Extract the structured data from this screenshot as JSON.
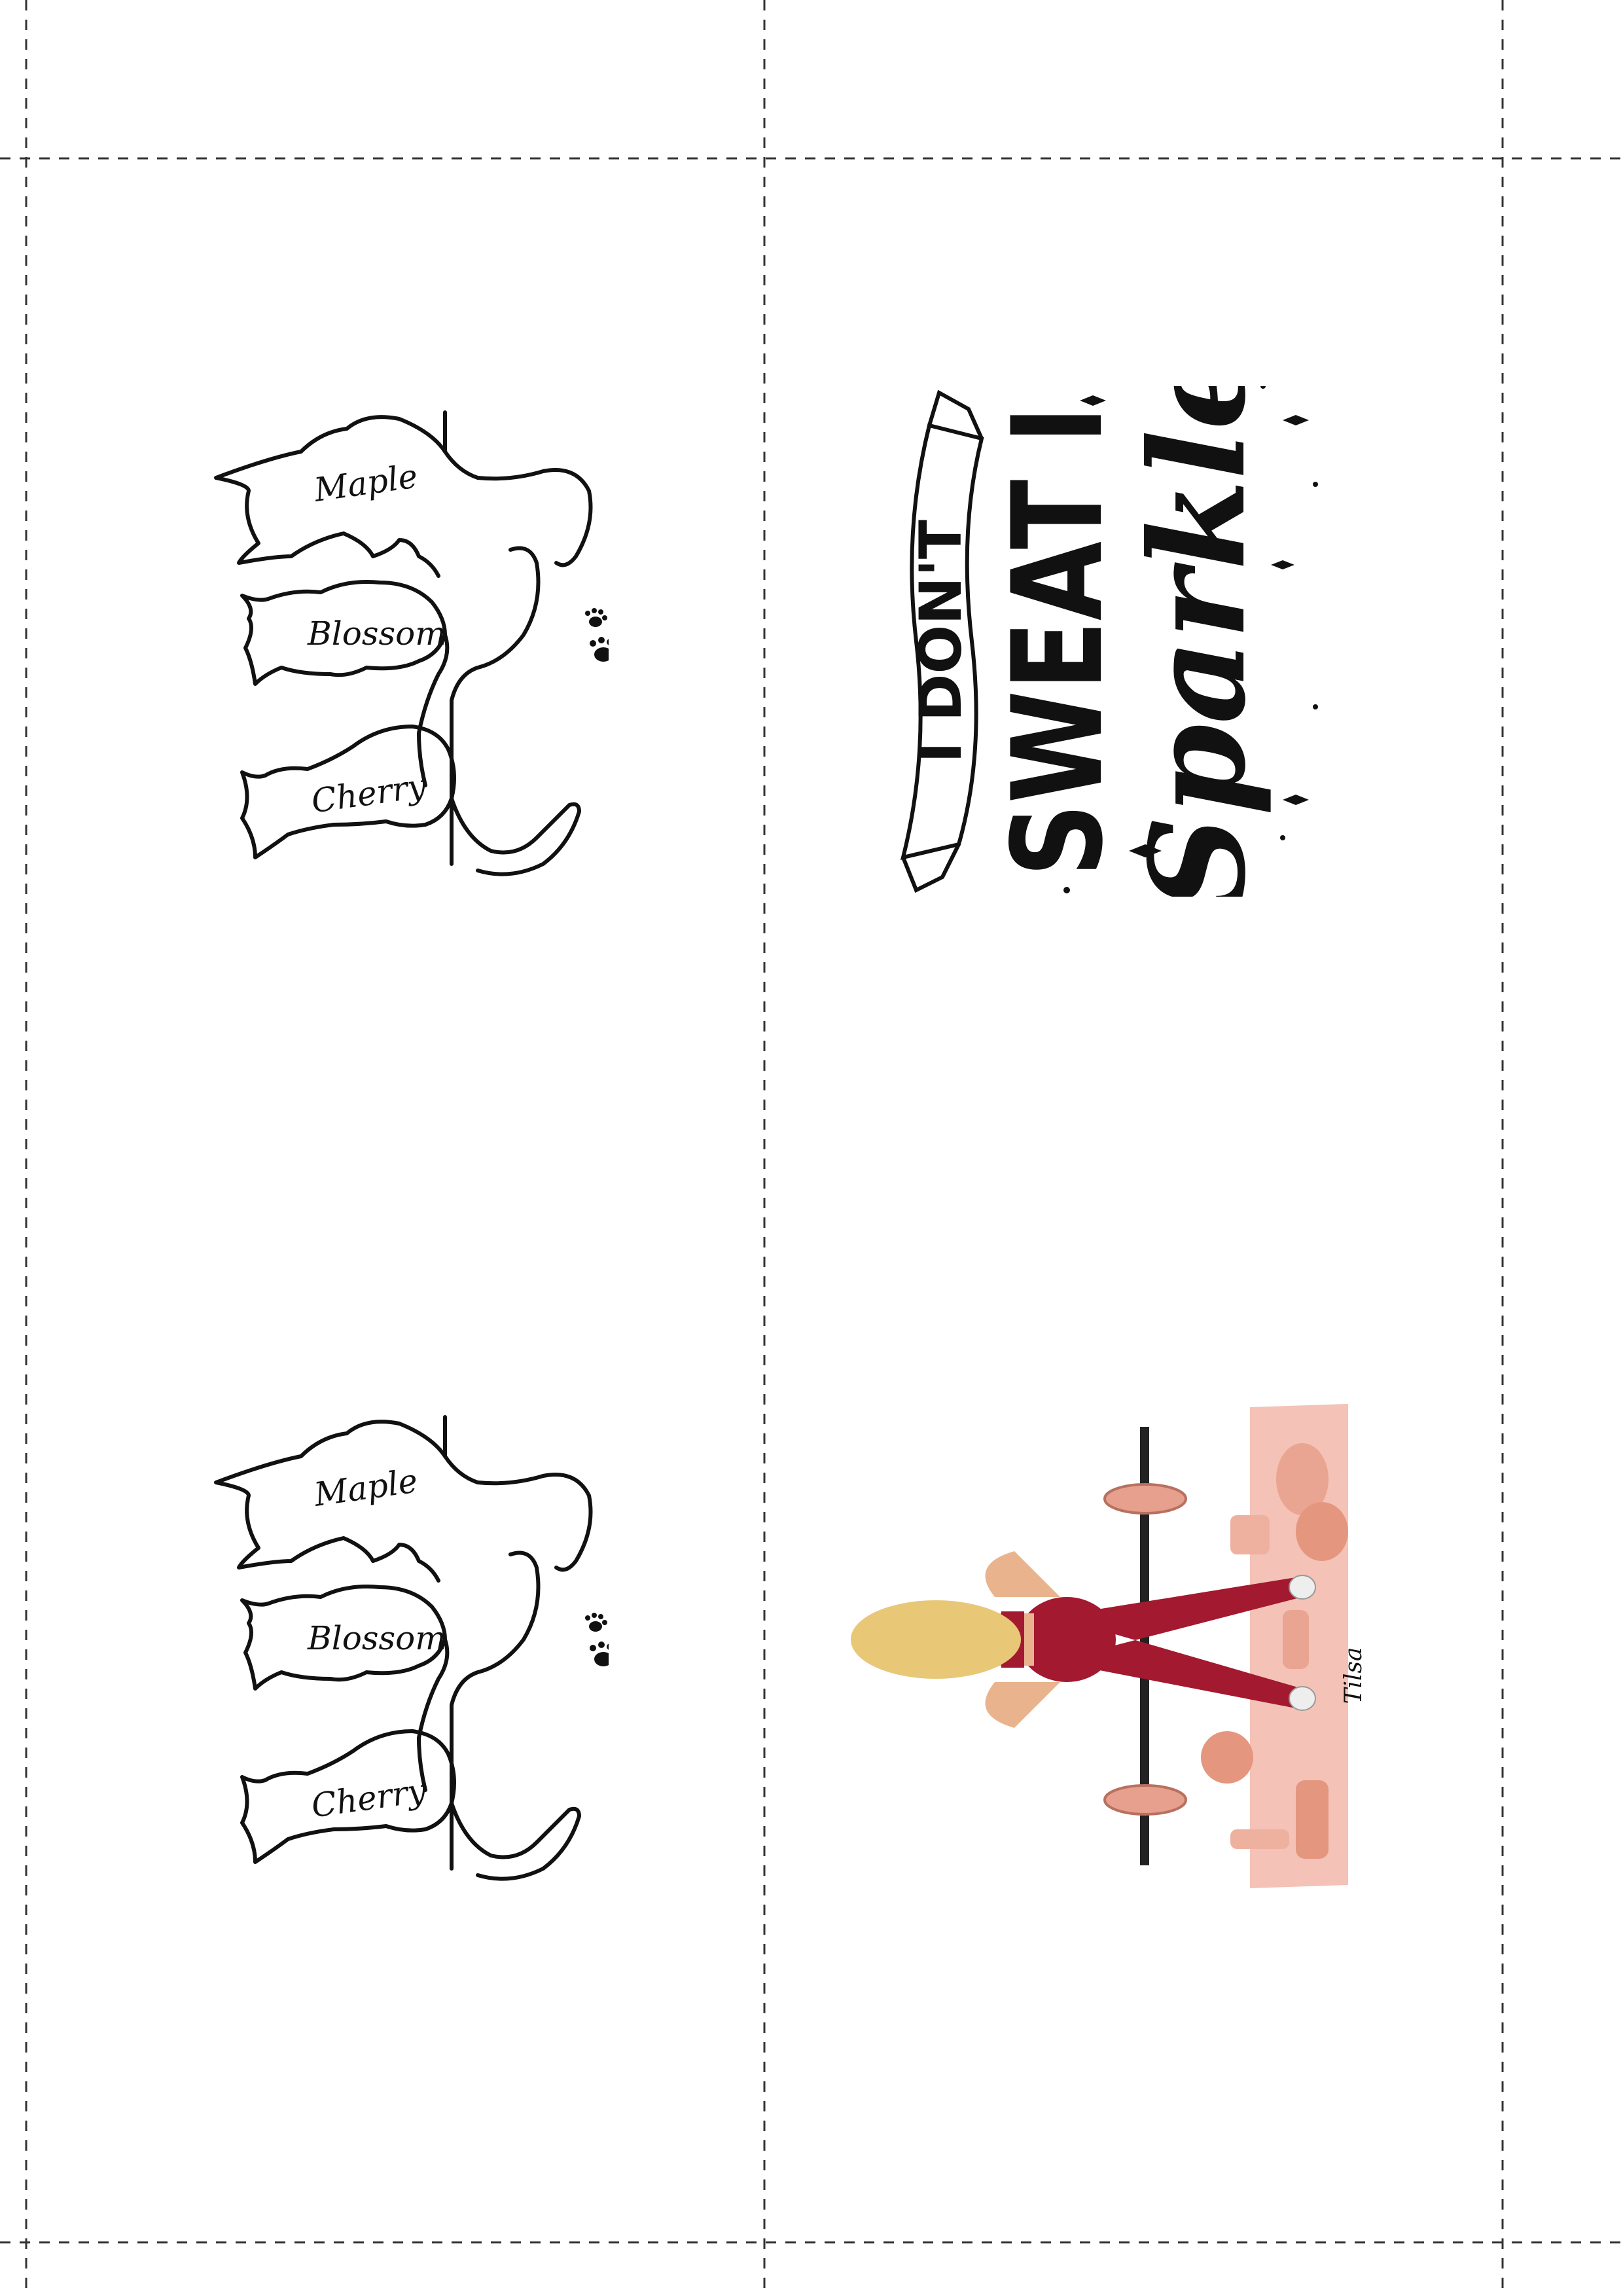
{
  "cat_designs": [
    {
      "names": [
        "Maple",
        "Blossom",
        "Cherry"
      ]
    },
    {
      "names": [
        "Maple",
        "Blossom",
        "Cherry"
      ]
    }
  ],
  "quote_design": {
    "banner_text": "I DON'T",
    "line2": "SWEAT I",
    "script_word": "Sparkle"
  },
  "gym_design": {
    "signature": "Tilsa"
  },
  "colors": {
    "cut_line": "#333333",
    "ink": "#111111",
    "mat": "#f4c2b6",
    "rose_gold": "#e7a08e",
    "leggings": "#a3192f",
    "hair": "#e8c777",
    "skin": "#e9b48d"
  },
  "icons": [
    "paw-prints-icon",
    "diamond-sparkle-icon"
  ]
}
